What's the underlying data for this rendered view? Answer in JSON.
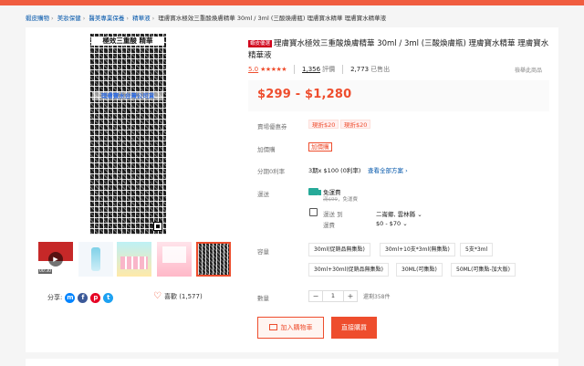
{
  "breadcrumb": {
    "items": [
      "蝦皮購物",
      "美妝保健",
      "醫美專業保養",
      "精華液"
    ],
    "current": "理膚寶水極效三重酸煥膚精華 30ml / 3ml (三酸煥膚瓶) 理膚寶水精華 理膚寶水精華液",
    "separator": "›"
  },
  "gallery": {
    "poster_title": "極效三重酸 精華",
    "poster_overlay": "理膚寶水台灣公司貨",
    "video_duration": "00:30",
    "play_icon": "▶"
  },
  "share": {
    "label": "分享:"
  },
  "favorite": {
    "label": "喜歡 (1,577)"
  },
  "product": {
    "badge": "蝦皮優選",
    "title": "理膚寶水極效三重酸煥膚精華 30ml / 3ml (三酸煥膚瓶) 理膚寶水精華 理膚寶水精華液",
    "rating": "5.0",
    "stars": "★★★★★",
    "reviews_count": "1,356",
    "reviews_label": "評價",
    "sold_count": "2,773",
    "sold_label": "已售出",
    "report_label": "檢舉此商品",
    "price": "$299 - $1,280"
  },
  "rows": {
    "voucher_label": "賣場優惠券",
    "vouchers": [
      "現折$20",
      "現折$20"
    ],
    "addon_label": "加價購",
    "addon_tag": "加價購",
    "installment_label": "分期0利率",
    "installment_value": "3期x $100 (0利率)",
    "installment_link": "查看全部方案 ›",
    "shipping_label": "運送",
    "free_shipping": "免運費",
    "free_sub_strike": "滿$99",
    "free_sub_rest": "，免運費",
    "ship_to_label": "運送 到",
    "ship_to_value": "二崙鄉, 雲林縣 ⌄",
    "fee_label": "運費",
    "fee_value": "$0 - $70 ⌄",
    "capacity_label": "容量",
    "options": [
      "30ml(促銷品無集點)",
      "30ml+10支*3ml(無集點)",
      "5支*3ml",
      "30ml+30ml(促銷品無集點)",
      "30ML(可集點)",
      "50ML(可集點-加大版)"
    ],
    "quantity_label": "數量",
    "quantity_value": "1",
    "minus": "−",
    "plus": "+",
    "stock": "還剩358件"
  },
  "actions": {
    "add_to_cart": "加入購物車",
    "buy_now": "直接購買"
  },
  "colors": {
    "brand": "#ee4d2d",
    "teal": "#26aa99",
    "link": "#0055aa"
  }
}
